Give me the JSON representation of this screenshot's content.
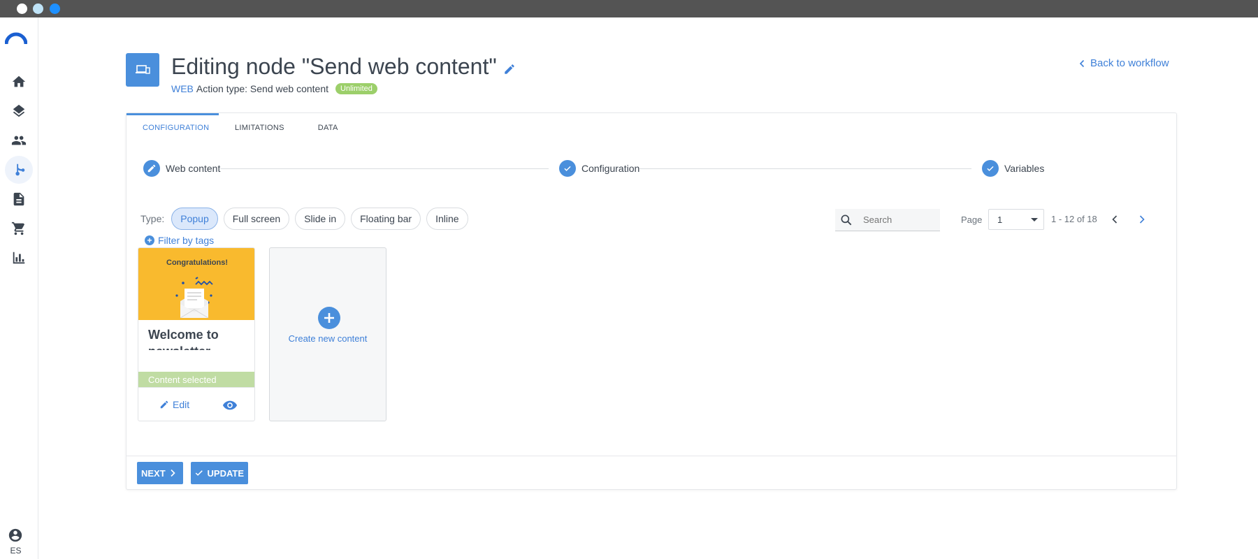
{
  "header": {
    "title": "Editing node \"Send web content\"",
    "channel": "WEB",
    "action_type": "Action type: Send web content",
    "badge": "Unlimited",
    "back_link": "Back to workflow"
  },
  "sidebar": {
    "items": [
      {
        "icon": "home-icon"
      },
      {
        "icon": "layers-icon"
      },
      {
        "icon": "people-icon"
      },
      {
        "icon": "workflow-icon",
        "active": true
      },
      {
        "icon": "document-icon"
      },
      {
        "icon": "cart-icon"
      },
      {
        "icon": "bar-chart-icon"
      }
    ],
    "language": "ES"
  },
  "tabs": [
    {
      "label": "CONFIGURATION",
      "active": true
    },
    {
      "label": "LIMITATIONS"
    },
    {
      "label": "DATA"
    }
  ],
  "steps": [
    {
      "label": "Web content",
      "icon": "pencil-icon"
    },
    {
      "label": "Configuration",
      "icon": "check-icon"
    },
    {
      "label": "Variables",
      "icon": "check-icon"
    }
  ],
  "filters": {
    "type_label": "Type:",
    "types": [
      "Popup",
      "Full screen",
      "Slide in",
      "Floating bar",
      "Inline"
    ],
    "selected_type": "Popup",
    "filter_tags": "Filter by tags",
    "search_placeholder": "Search"
  },
  "pagination": {
    "page_label": "Page",
    "page_value": "1",
    "range": "1 - 12 of 18"
  },
  "contents": [
    {
      "thumb_title": "Congratulations!",
      "name": "Welcome to newsletter",
      "status": "Content selected",
      "edit_label": "Edit"
    }
  ],
  "create_label": "Create new content",
  "footer": {
    "next_label": "NEXT",
    "update_label": "UPDATE"
  },
  "colors": {
    "accent": "#4a8fdc",
    "link": "#3f80d8",
    "badge": "#9ccf6a",
    "thumb_bg": "#f9ba2e",
    "selected_bar": "#c0dca3"
  }
}
